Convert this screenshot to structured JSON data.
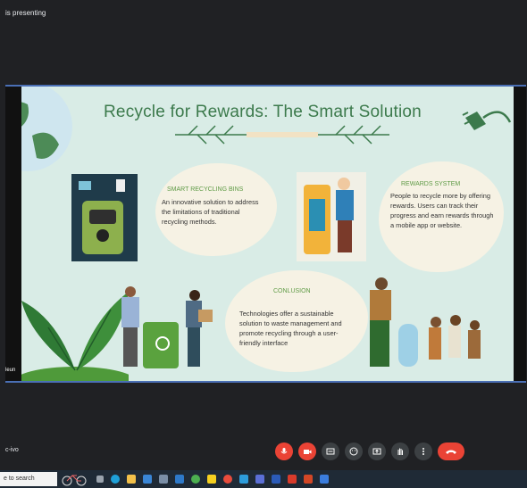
{
  "meet": {
    "presenting_label": "is presenting",
    "presenter_name_tile": "leun",
    "user_label": "c-ivo"
  },
  "slide": {
    "title": "Recycle for Rewards: The Smart Solution",
    "cards": [
      {
        "heading": "SMART RECYCLING BINS",
        "body": "An innovative solution to address the limitations of traditional recycling methods."
      },
      {
        "heading": "REWARDS SYSTEM",
        "body": "People to recycle more by offering rewards. Users can track their progress and earn rewards through a mobile app or website."
      },
      {
        "heading": "CONLUSION",
        "body": "Technologies offer a sustainable solution to waste management and promote recycling through a user-friendly interface"
      }
    ]
  },
  "controls": [
    {
      "icon": "microphone-icon",
      "color": "#ea4335"
    },
    {
      "icon": "camera-icon",
      "color": "#ea4335"
    },
    {
      "icon": "captions-icon",
      "color": "#3c4043"
    },
    {
      "icon": "emoji-icon",
      "color": "#3c4043"
    },
    {
      "icon": "present-icon",
      "color": "#3c4043"
    },
    {
      "icon": "raise-hand-icon",
      "color": "#3c4043"
    },
    {
      "icon": "more-options-icon",
      "color": "#3c4043"
    },
    {
      "icon": "leave-call-icon",
      "color": "#ea4335"
    }
  ],
  "taskbar": {
    "search_text": "e to search"
  }
}
